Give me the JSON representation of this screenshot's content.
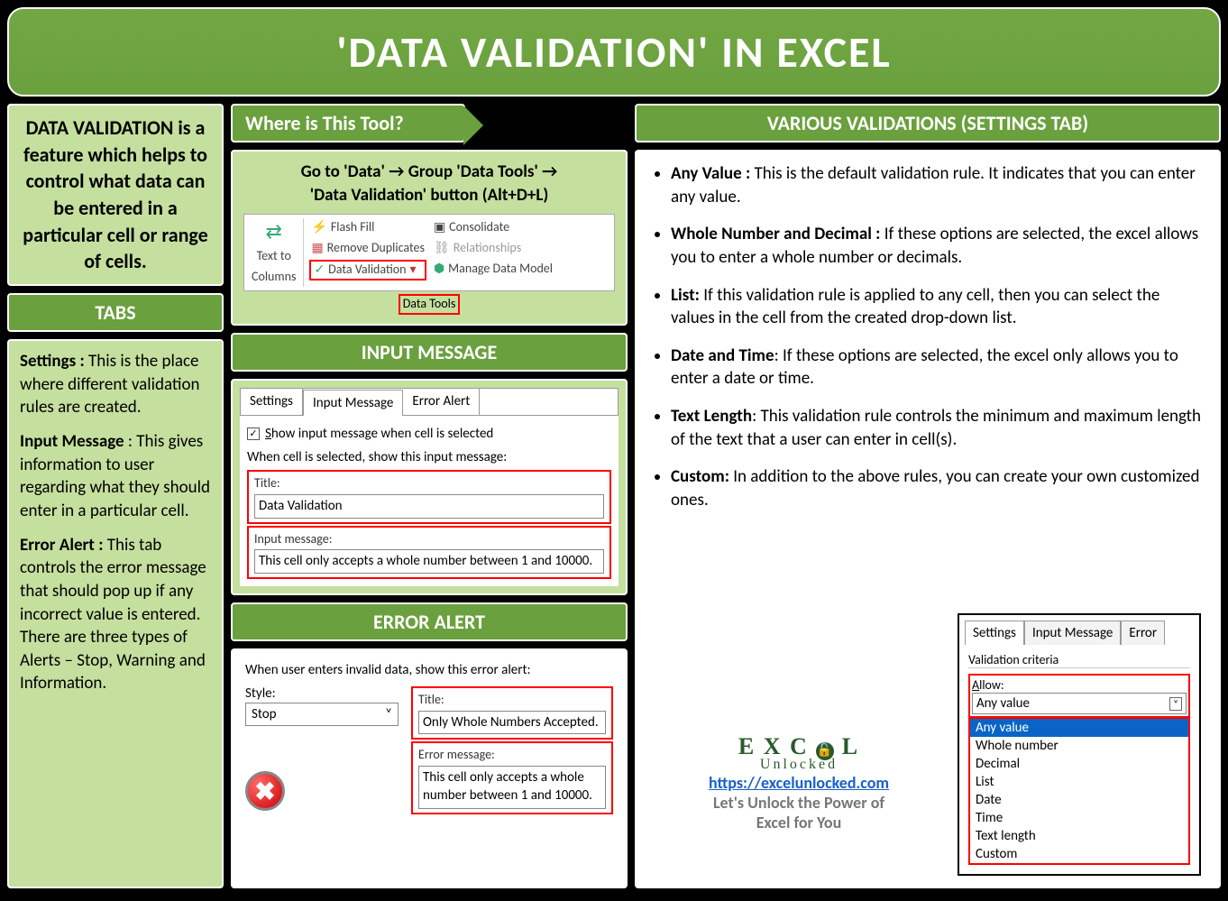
{
  "title": "'DATA VALIDATION' IN EXCEL",
  "intro": "DATA VALIDATION is a feature which helps to control what data can be entered in a particular cell or range of cells.",
  "tabs_header": "TABS",
  "tabs": {
    "settings_b": "Settings :",
    "settings": " This is the place where different validation rules are created.",
    "input_b": "Input Message",
    "input": " : This gives information to user regarding what they should enter in a particular cell.",
    "error_b": "Error Alert :",
    "error": " This tab controls the error message that should pop up if any incorrect value is entered. There are three types of Alerts – Stop, Warning and Information."
  },
  "where_header": "Where is This Tool?",
  "where_path1": "Go to 'Data' → Group 'Data Tools' →",
  "where_path2": "'Data Validation' button (Alt+D+L)",
  "ribbon": {
    "text_to": "Text to",
    "columns": "Columns",
    "flash": "Flash Fill",
    "remove": "Remove Duplicates",
    "datav": "Data Validation",
    "consolidate": "Consolidate",
    "relationships": "Relationships",
    "manage": "Manage Data Model",
    "group": "Data Tools"
  },
  "im_header": "INPUT MESSAGE",
  "im": {
    "tab_settings": "Settings",
    "tab_input": "Input Message",
    "tab_error": "Error Alert",
    "show_chk": "Show input message when cell is selected",
    "when": "When cell is selected, show this input message:",
    "title_lbl": "Title:",
    "title_val": "Data Validation",
    "msg_lbl": "Input message:",
    "msg_val": "This cell only accepts a whole number between 1 and 10000."
  },
  "ea_header": "ERROR ALERT",
  "ea": {
    "when": "When user enters invalid data, show this error alert:",
    "style_lbl": "Style:",
    "style_val": "Stop",
    "title_lbl": "Title:",
    "title_val": "Only Whole Numbers Accepted.",
    "msg_lbl": "Error message:",
    "msg_val": "This cell only accepts a whole number between 1 and 10000."
  },
  "validations_header": "VARIOUS VALIDATIONS (SETTINGS TAB)",
  "validations": [
    {
      "b": "Any Value :",
      "t": "  This is the default validation rule. It indicates that you can enter any value."
    },
    {
      "b": "Whole Number and Decimal :",
      "t": " If these options are selected, the excel allows you to enter a whole number or decimals."
    },
    {
      "b": "List:",
      "t": " If this validation rule is applied to any cell, then you can select the values in the cell from the created drop-down list."
    },
    {
      "b": "Date and Time",
      "t": ": If these options are selected, the excel only allows you to enter a date or time."
    },
    {
      "b": "Text Length",
      "t": ": This validation rule controls the minimum and maximum length of the text that a user can enter in cell(s)."
    },
    {
      "b": "Custom:",
      "t": " In addition to the above rules, you can create your own customized ones."
    }
  ],
  "logo": {
    "title": "EXCEL",
    "sub": "Unlocked",
    "url": "https://excelunlocked.com",
    "tag1": "Let's Unlock the Power of",
    "tag2": "Excel for You"
  },
  "settings_panel": {
    "tab_s": "Settings",
    "tab_i": "Input Message",
    "tab_e": "Error",
    "vc": "Validation criteria",
    "allow": "Allow:",
    "sel": "Any value",
    "opts": [
      "Any value",
      "Whole number",
      "Decimal",
      "List",
      "Date",
      "Time",
      "Text length",
      "Custom"
    ]
  }
}
